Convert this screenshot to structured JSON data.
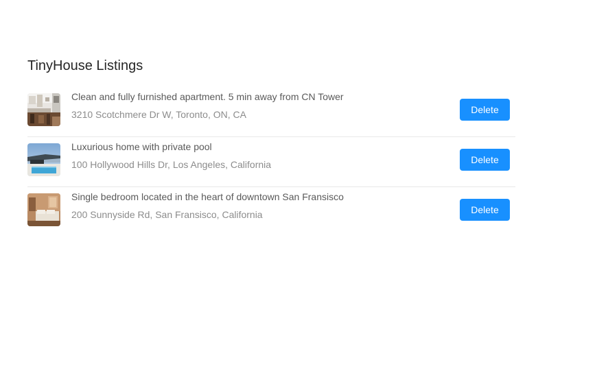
{
  "page": {
    "title": "TinyHouse Listings"
  },
  "listings": [
    {
      "title": "Clean and fully furnished apartment. 5 min away from CN Tower",
      "address": "3210 Scotchmere Dr W, Toronto, ON, CA",
      "image": "apartment-kitchen-photo",
      "delete_label": "Delete"
    },
    {
      "title": "Luxurious home with private pool",
      "address": "100 Hollywood Hills Dr, Los Angeles, California",
      "image": "pool-house-photo",
      "delete_label": "Delete"
    },
    {
      "title": "Single bedroom located in the heart of downtown San Fransisco",
      "address": "200 Sunnyside Rd, San Fransisco, California",
      "image": "bedroom-photo",
      "delete_label": "Delete"
    }
  ],
  "colors": {
    "primary_button": "#1890ff",
    "title_text": "#262626",
    "item_title_text": "#595959",
    "address_text": "#8c8c8c",
    "divider": "#e8e8e8"
  }
}
